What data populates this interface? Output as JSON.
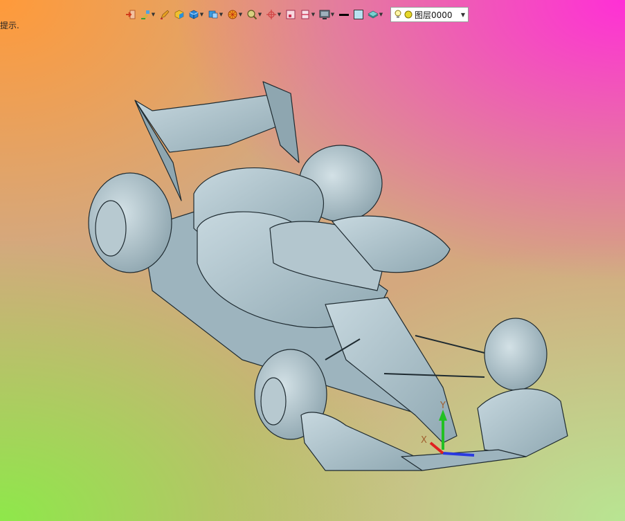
{
  "viewport": {
    "hint_text": "提示."
  },
  "toolbar": {
    "tools": [
      {
        "icon": "import-arrow-icon",
        "has_menu": false
      },
      {
        "icon": "brush-paint-icon",
        "has_menu": true
      },
      {
        "icon": "pencil-icon",
        "has_menu": false
      },
      {
        "icon": "shaded-box-icon",
        "has_menu": false
      },
      {
        "icon": "solid-cube-icon",
        "has_menu": true
      },
      {
        "icon": "box-section-icon",
        "has_menu": true
      },
      {
        "icon": "wheel-display-icon",
        "has_menu": true
      },
      {
        "icon": "zoom-lens-icon",
        "has_menu": true
      },
      {
        "icon": "axis-orient-icon",
        "has_menu": true
      },
      {
        "icon": "frame-select-icon",
        "has_menu": false
      },
      {
        "icon": "column-select-icon",
        "has_menu": true
      },
      {
        "icon": "monitor-view-icon",
        "has_menu": true
      },
      {
        "icon": "line-color-icon",
        "has_menu": false
      },
      {
        "icon": "fill-color-icon",
        "has_menu": false
      },
      {
        "icon": "layer-stack-icon",
        "has_menu": true
      }
    ],
    "layer": {
      "label": "图层0000"
    }
  },
  "model": {
    "triad": {
      "x_label": "X",
      "y_label": "Y"
    },
    "colors": {
      "body": "#a4bcc6",
      "edge": "#1e2a30"
    }
  }
}
